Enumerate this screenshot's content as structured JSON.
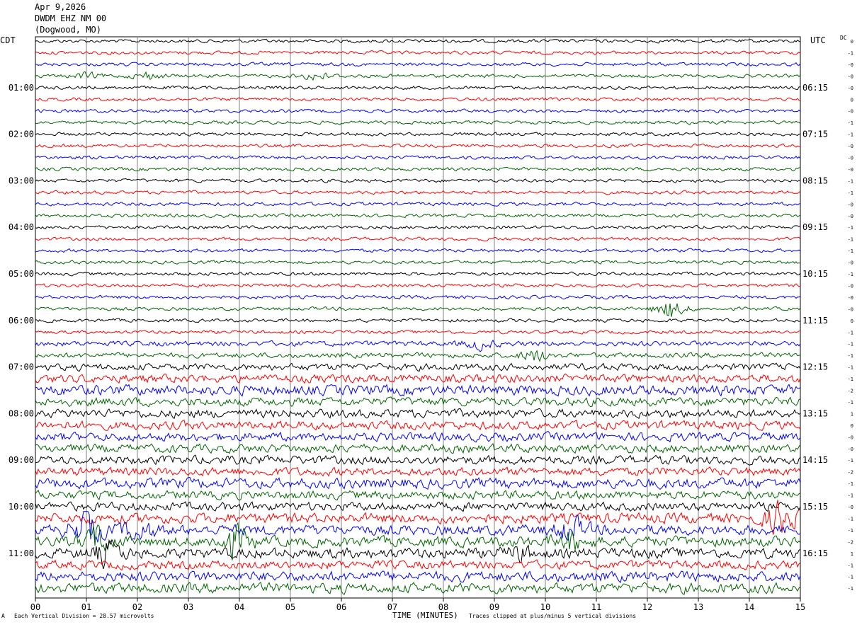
{
  "header": {
    "date": "Apr 9,2026",
    "station": "DWDM EHZ NM 00",
    "location": "(Dogwood, MO)"
  },
  "left_timezone": "CDT",
  "right_timezone": "UTC",
  "dc_header": "DC",
  "footer": {
    "scale_note": "Each Vertical Division =   28.57 microvolts",
    "clip_note": "Traces clipped at plus/minus 5 vertical divisions",
    "corner_mark": "A"
  },
  "colors": {
    "trace_cycle": [
      "#000000",
      "#ff0000",
      "#0000ff",
      "#006400"
    ],
    "grid": "#808080"
  },
  "chart_data": {
    "type": "line",
    "title": "",
    "xlabel": "TIME (MINUTES)",
    "x_ticks": [
      "00",
      "01",
      "02",
      "03",
      "04",
      "05",
      "06",
      "07",
      "08",
      "09",
      "10",
      "11",
      "12",
      "13",
      "14",
      "15"
    ],
    "xlim": [
      0,
      15
    ],
    "left_hour_labels": [
      "01:00",
      "02:00",
      "03:00",
      "04:00",
      "05:00",
      "06:00",
      "07:00",
      "08:00",
      "09:00",
      "10:00",
      "11:00"
    ],
    "right_hour_labels": [
      "06:15",
      "07:15",
      "08:15",
      "09:15",
      "10:15",
      "11:15",
      "12:15",
      "13:15",
      "14:15",
      "15:15",
      "16:15"
    ],
    "trace_count": 48,
    "traces_per_hour": 4,
    "minutes_per_trace": 15,
    "dc_offsets": [
      "0",
      "-1",
      "-0",
      "-0",
      "-0",
      "0",
      "-0",
      "-1",
      "-1",
      "-0",
      "-0",
      "-0",
      "-1",
      "-1",
      "-0",
      "-0",
      "-1",
      "-1",
      "-1",
      "-0",
      "-1",
      "-0",
      "-0",
      "-0",
      "0",
      "-1",
      "-1",
      "-1",
      "-1",
      "-1",
      "-2",
      "-1",
      "1",
      "0",
      "-0",
      "-0",
      "-1",
      "-2",
      "-1",
      "-1",
      "-0",
      "-1",
      "-1",
      "-2",
      "1",
      "-1",
      "-1",
      "-1"
    ],
    "noise_level": [
      2,
      2,
      2,
      2,
      2,
      2,
      2,
      2,
      2,
      2,
      2,
      2,
      2,
      2,
      2,
      2,
      2,
      2,
      2,
      2,
      2,
      2,
      2,
      2,
      2,
      2,
      3,
      3,
      4,
      5,
      6,
      5,
      5,
      5,
      5,
      5,
      5,
      5,
      6,
      5,
      5,
      6,
      6,
      6,
      6,
      5,
      6,
      6
    ],
    "events": [
      {
        "trace": 3,
        "minute": 1.0,
        "amp": 4
      },
      {
        "trace": 3,
        "minute": 2.2,
        "amp": 5
      },
      {
        "trace": 3,
        "minute": 5.5,
        "amp": 6
      },
      {
        "trace": 23,
        "minute": 12.45,
        "amp": 14
      },
      {
        "trace": 26,
        "minute": 8.7,
        "amp": 6
      },
      {
        "trace": 27,
        "minute": 9.8,
        "amp": 8
      },
      {
        "trace": 41,
        "minute": 14.6,
        "amp": 22
      },
      {
        "trace": 42,
        "minute": 1.0,
        "amp": 26
      },
      {
        "trace": 42,
        "minute": 2.0,
        "amp": 14
      },
      {
        "trace": 42,
        "minute": 10.5,
        "amp": 16
      },
      {
        "trace": 43,
        "minute": 1.2,
        "amp": 18
      },
      {
        "trace": 43,
        "minute": 3.9,
        "amp": 22
      },
      {
        "trace": 43,
        "minute": 10.5,
        "amp": 12
      },
      {
        "trace": 44,
        "minute": 1.4,
        "amp": 16
      },
      {
        "trace": 44,
        "minute": 9.5,
        "amp": 8
      }
    ]
  }
}
